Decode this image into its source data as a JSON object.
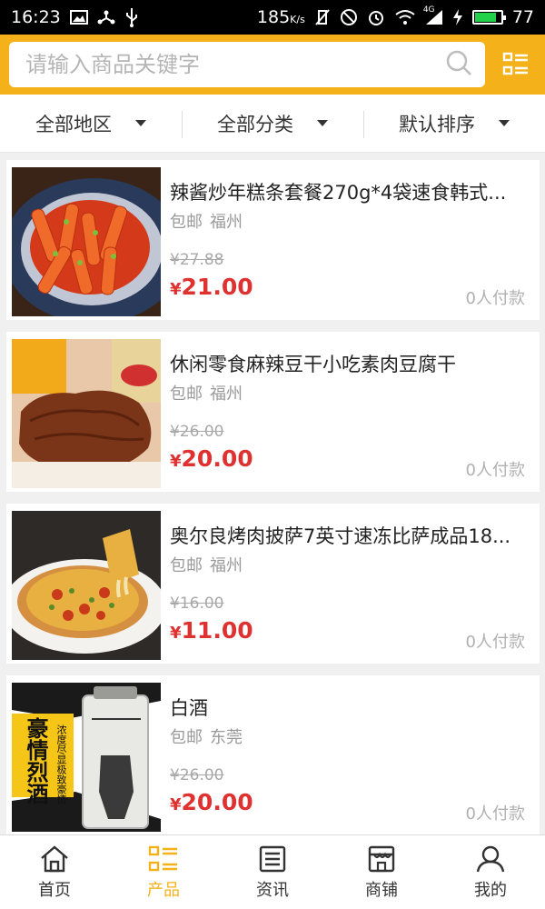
{
  "status_bar": {
    "time": "16:23",
    "speed": "185",
    "speed_unit": "K/s",
    "network": "4G",
    "battery_level": "77"
  },
  "search": {
    "placeholder": "请输入商品关键字"
  },
  "filters": [
    {
      "label": "全部地区"
    },
    {
      "label": "全部分类"
    },
    {
      "label": "默认排序"
    }
  ],
  "products": [
    {
      "title": "辣酱炒年糕条套餐270g*4袋速食韩式...",
      "shipping": "包邮",
      "location": "福州",
      "original_price": "¥27.88",
      "currency": "¥",
      "price": "21.00",
      "paid": "0人付款"
    },
    {
      "title": "休闲零食麻辣豆干小吃素肉豆腐干",
      "shipping": "包邮",
      "location": "福州",
      "original_price": "¥26.00",
      "currency": "¥",
      "price": "20.00",
      "paid": "0人付款"
    },
    {
      "title": "奥尔良烤肉披萨7英寸速冻比萨成品18...",
      "shipping": "包邮",
      "location": "福州",
      "original_price": "¥16.00",
      "currency": "¥",
      "price": "11.00",
      "paid": "0人付款"
    },
    {
      "title": "白酒",
      "shipping": "包邮",
      "location": "东莞",
      "original_price": "¥26.00",
      "currency": "¥",
      "price": "20.00",
      "paid": "0人付款"
    }
  ],
  "product_images": {
    "liquor_slogan": "豪情烈酒",
    "liquor_sub": "浓度尽显极致豪情"
  },
  "tabs": [
    {
      "label": "首页",
      "icon": "home-icon"
    },
    {
      "label": "产品",
      "icon": "list-icon"
    },
    {
      "label": "资讯",
      "icon": "news-icon"
    },
    {
      "label": "商铺",
      "icon": "shop-icon"
    },
    {
      "label": "我的",
      "icon": "user-icon"
    }
  ],
  "colors": {
    "accent": "#f5b11a",
    "price": "#e03131",
    "battery": "#22d14a"
  }
}
